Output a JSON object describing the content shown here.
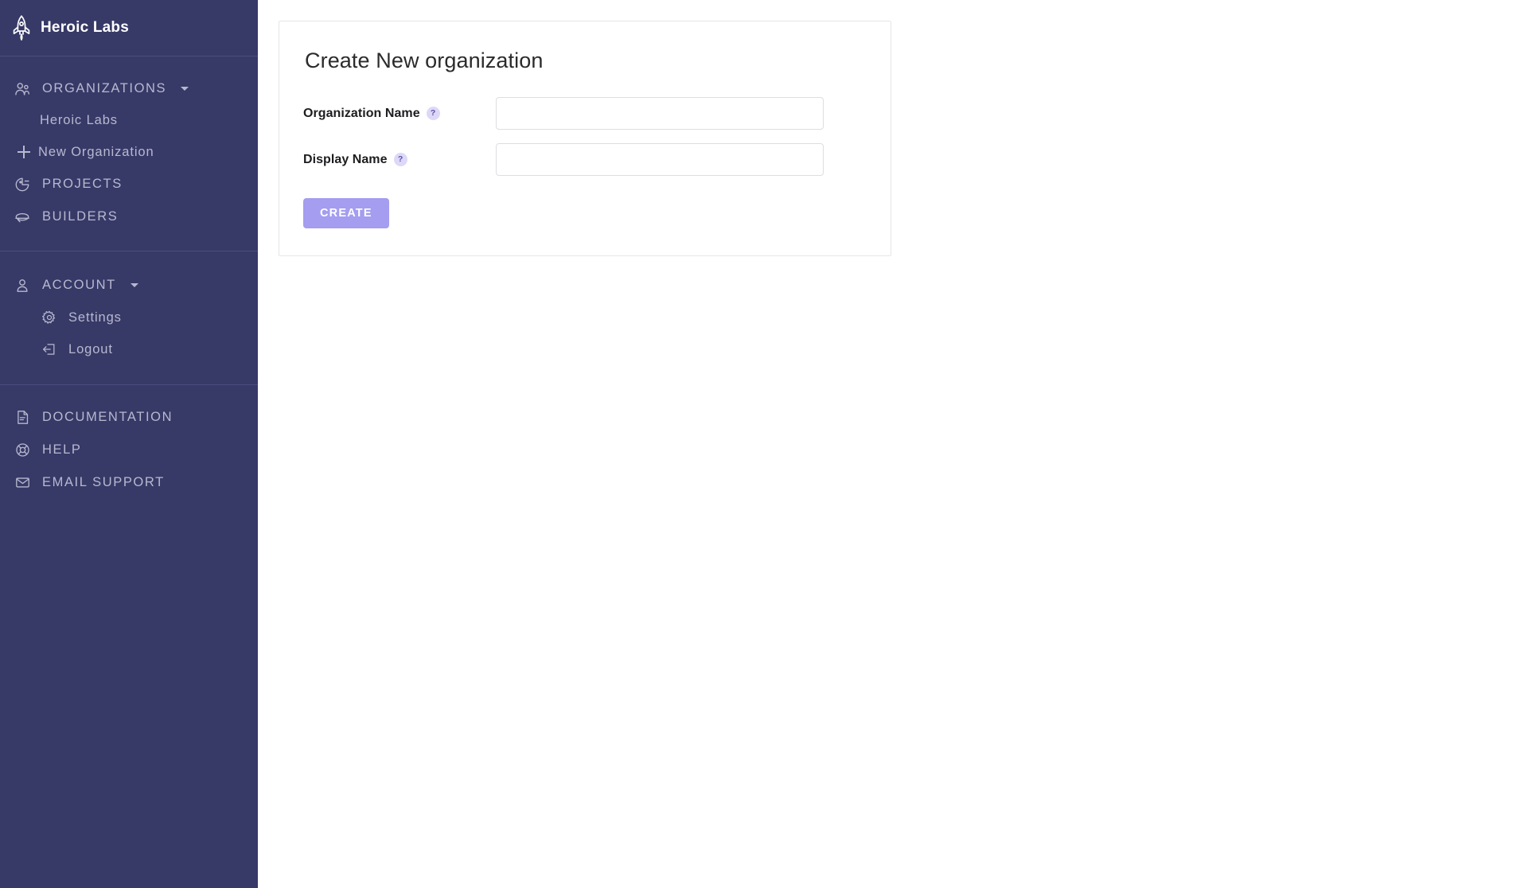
{
  "brand": {
    "name": "Heroic Labs",
    "logo_icon": "rocket-icon"
  },
  "sidebar": {
    "sections": [
      {
        "name": "organizations",
        "items": [
          {
            "label": "ORGANIZATIONS",
            "icon": "users-icon",
            "kind": "group",
            "caret": true
          },
          {
            "label": "Heroic Labs",
            "icon": "none",
            "kind": "sub"
          },
          {
            "label": "New Organization",
            "icon": "plus-icon",
            "kind": "plus"
          },
          {
            "label": "PROJECTS",
            "icon": "projects-icon",
            "kind": "group"
          },
          {
            "label": "BUILDERS",
            "icon": "builders-icon",
            "kind": "group"
          }
        ]
      },
      {
        "name": "account",
        "items": [
          {
            "label": "ACCOUNT",
            "icon": "person-icon",
            "kind": "group",
            "caret": true
          },
          {
            "label": "Settings",
            "icon": "gear-icon",
            "kind": "subicon"
          },
          {
            "label": "Logout",
            "icon": "logout-icon",
            "kind": "subicon"
          }
        ]
      },
      {
        "name": "footer",
        "items": [
          {
            "label": "DOCUMENTATION",
            "icon": "document-icon",
            "kind": "group"
          },
          {
            "label": "HELP",
            "icon": "lifebuoy-icon",
            "kind": "group"
          },
          {
            "label": "EMAIL SUPPORT",
            "icon": "envelope-icon",
            "kind": "group"
          }
        ]
      }
    ]
  },
  "main": {
    "card": {
      "title": "Create New organization",
      "fields": [
        {
          "label": "Organization Name",
          "help": "?",
          "value": "",
          "placeholder": ""
        },
        {
          "label": "Display Name",
          "help": "?",
          "value": "",
          "placeholder": ""
        }
      ],
      "submit_label": "CREATE"
    }
  },
  "colors": {
    "sidebar_bg": "#373a67",
    "sidebar_text": "#b8b8d0",
    "sidebar_divider": "#4b4e7c",
    "accent": "#a49df0",
    "help_badge_bg": "#ddd8f8",
    "help_badge_text": "#5b55a8",
    "card_border": "#e6e6ea",
    "input_border": "#dedee3",
    "page_bg": "#ffffff"
  }
}
